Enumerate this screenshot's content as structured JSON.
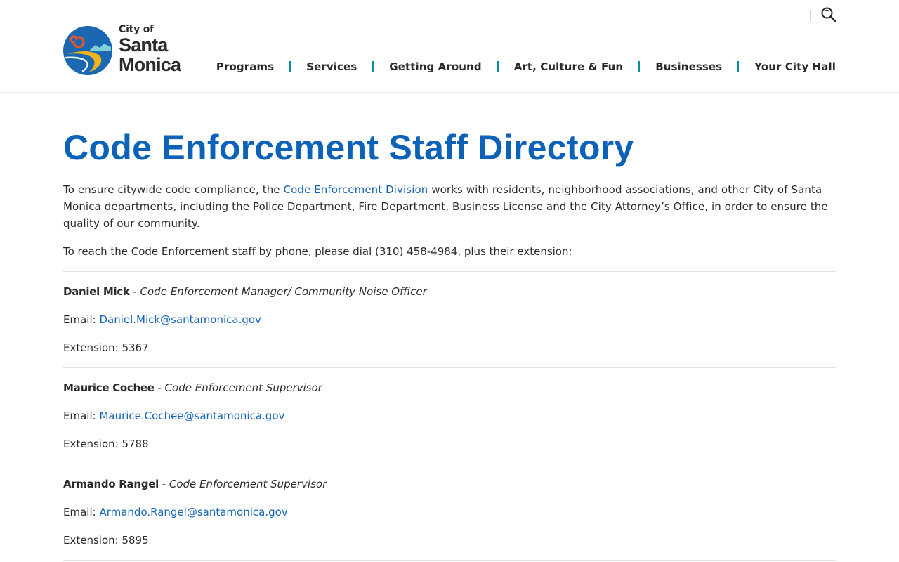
{
  "logo": {
    "line1": "City of",
    "line2": "Santa",
    "line3": "Monica",
    "colors": {
      "circle": "#1b67b2",
      "sun": "#e4572e",
      "sand": "#f3b31a",
      "wave": "#7fd0d8"
    }
  },
  "header": {
    "search_icon": "search-icon",
    "nav": [
      {
        "label": "Programs"
      },
      {
        "label": "Services"
      },
      {
        "label": "Getting Around"
      },
      {
        "label": "Art, Culture & Fun"
      },
      {
        "label": "Businesses"
      },
      {
        "label": "Your City Hall"
      }
    ]
  },
  "page": {
    "title": "Code Enforcement Staff Directory",
    "intro_before": "To ensure citywide code compliance, the ",
    "intro_link": "Code Enforcement Division",
    "intro_after": " works with residents, neighborhood associations, and other City of Santa Monica departments, including the Police Department, Fire Department, Business License and the City Attorney’s Office, in order to ensure the quality of our community.",
    "dial_text": "To reach the Code Enforcement staff by phone, please dial (310) 458-4984, plus their extension:"
  },
  "staff": [
    {
      "name": "Daniel Mick",
      "separator": " - ",
      "title": "Code Enforcement Manager/ Community Noise Officer",
      "email_label": "Email: ",
      "email": "Daniel.Mick@santamonica.gov",
      "extension": "Extension: 5367"
    },
    {
      "name": "Maurice Cochee",
      "separator": " - ",
      "title": "Code Enforcement Supervisor",
      "email_label": "Email: ",
      "email": "Maurice.Cochee@santamonica.gov",
      "extension": "Extension: 5788"
    },
    {
      "name": "Armando Rangel",
      "separator": " - ",
      "title": "Code Enforcement Supervisor",
      "email_label": "Email: ",
      "email": "Armando.Rangel@santamonica.gov",
      "extension": "Extension: 5895"
    }
  ],
  "colors": {
    "title": "#0b62b8",
    "link": "#1565b6",
    "nav_separator": "#0f8e9a",
    "text": "#2b2b2b"
  }
}
